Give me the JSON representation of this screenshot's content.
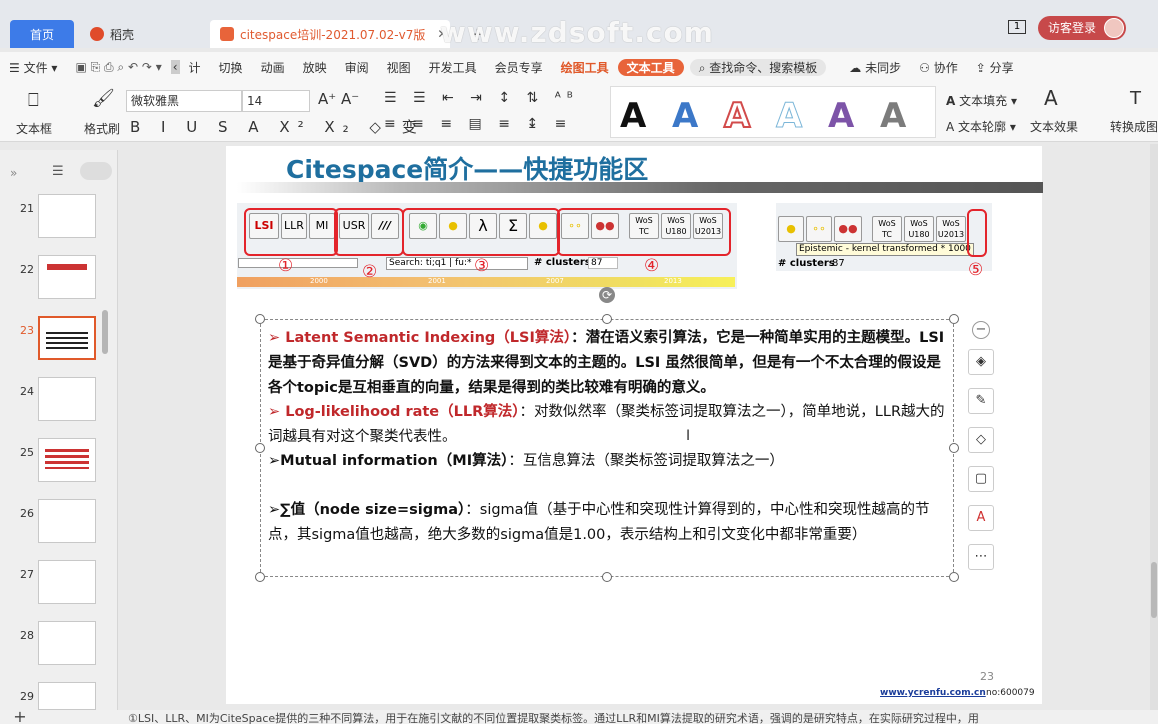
{
  "tabs": {
    "home": "首页",
    "daoke": "稻壳",
    "doc": "citespace培训-2021.07.02-v7版"
  },
  "watermark": "www.zdsoft.com",
  "login": "访客登录",
  "page_indicator": "1",
  "menu": {
    "file": "文件",
    "items": [
      "计",
      "切换",
      "动画",
      "放映",
      "审阅",
      "视图",
      "开发工具",
      "会员专享"
    ],
    "draw_tools": "绘图工具",
    "text_tools": "文本工具",
    "search": "查找命令、搜索模板",
    "unsynced": "未同步",
    "collab": "协作",
    "share": "分享"
  },
  "ribbon": {
    "textbox": "文本框",
    "format_brush": "格式刷",
    "font": "微软雅黑",
    "size": "14",
    "fill": "文本填充",
    "outline": "文本轮廓",
    "effect": "文本效果",
    "convert": "转换成图"
  },
  "slides": [
    "21",
    "22",
    "23",
    "24",
    "25",
    "26",
    "27",
    "28",
    "29"
  ],
  "slide": {
    "title": "Citespace简介——快捷功能区",
    "toolbar_buttons": [
      "LSI",
      "LLR",
      "MI",
      "USR",
      "///",
      "λ",
      "Σ"
    ],
    "wos": [
      "WoS TC",
      "WoS U180",
      "WoS U2013"
    ],
    "search_text": "Search: ti;q1 | fu:*",
    "clusters_label": "# clusters",
    "clusters_value": "87",
    "tooltip": "Epistemic - kernel transformed * 1000",
    "timeline": [
      "2000",
      "2001",
      "2007",
      "2013"
    ],
    "circles": [
      "①",
      "②",
      "③",
      "④",
      "⑤"
    ],
    "p1_head": "Latent Semantic Indexing（LSI算法）",
    "p1_body": "：潜在语义索引算法，它是一种简单实用的主题模型。LSI是基于奇异值分解（SVD）的方法来得到文本的主题的。LSI 虽然很简单，但是有一个不太合理的假设是各个topic是互相垂直的向量，结果是得到的类比较难有明确的意义。",
    "p2_head": "Log-likelihood rate（LLR算法）",
    "p2_body": "：对数似然率（聚类标签词提取算法之一），简单地说，LLR越大的词越具有对这个聚类代表性。",
    "p3_head": "Mutual information（MI算法）",
    "p3_body": "：互信息算法（聚类标签词提取算法之一）",
    "p4_head": "∑值（node size=sigma）",
    "p4_body": "：sigma值（基于中心性和突现性计算得到的，中心性和突现性越高的节点，其sigma值也越高，绝大多数的sigma值是1.00，表示结构上和引文变化中都非常重要）",
    "page_no": "23",
    "url": "www.ycrenfu.com.cn",
    "no": "no:600079"
  },
  "status": "①LSI、LLR、MI为CiteSpace提供的三种不同算法，用于在施引文献的不同位置提取聚类标签。通过LLR和MI算法提取的研究术语，强调的是研究特点，在实际研究过程中，用"
}
